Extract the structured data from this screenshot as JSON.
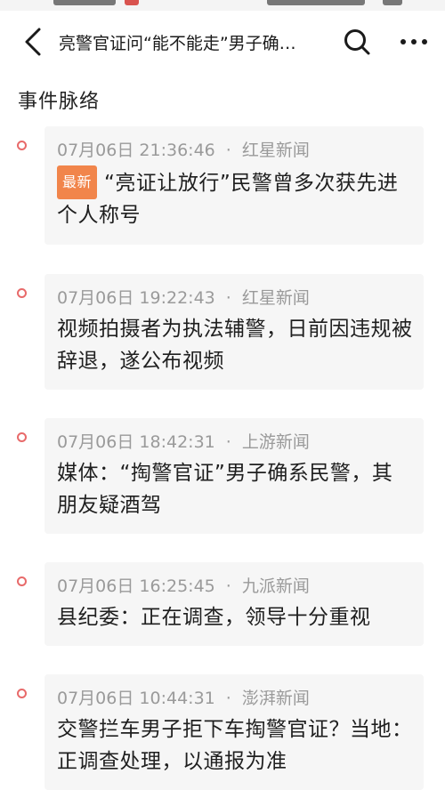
{
  "header": {
    "title": "亮警官证问“能不能走”男子确…",
    "back_icon": "chevron-left-icon",
    "search_icon": "search-icon",
    "more_icon": "more-dots-icon"
  },
  "section_title": "事件脉络",
  "events": [
    {
      "date": "07月06日",
      "time": "21:36:46",
      "source": "红星新闻",
      "badge": "最新",
      "headline": "“亮证让放行”民警曾多次获先进个人称号"
    },
    {
      "date": "07月06日",
      "time": "19:22:43",
      "source": "红星新闻",
      "badge": "",
      "headline": "视频拍摄者为执法辅警，日前因违规被辞退，遂公布视频"
    },
    {
      "date": "07月06日",
      "time": "18:42:31",
      "source": "上游新闻",
      "badge": "",
      "headline": "媒体：“掏警官证”男子确系民警，其朋友疑酒驾"
    },
    {
      "date": "07月06日",
      "time": "16:25:45",
      "source": "九派新闻",
      "badge": "",
      "headline": "县纪委：正在调查，领导十分重视"
    },
    {
      "date": "07月06日",
      "time": "10:44:31",
      "source": "澎湃新闻",
      "badge": "",
      "headline": "交警拦车男子拒下车掏警官证？当地：正调查处理，以通报为准"
    }
  ],
  "colors": {
    "accent_dot": "#e86a6a",
    "badge_bg": "#f1854b",
    "card_bg": "#f6f6f6"
  }
}
